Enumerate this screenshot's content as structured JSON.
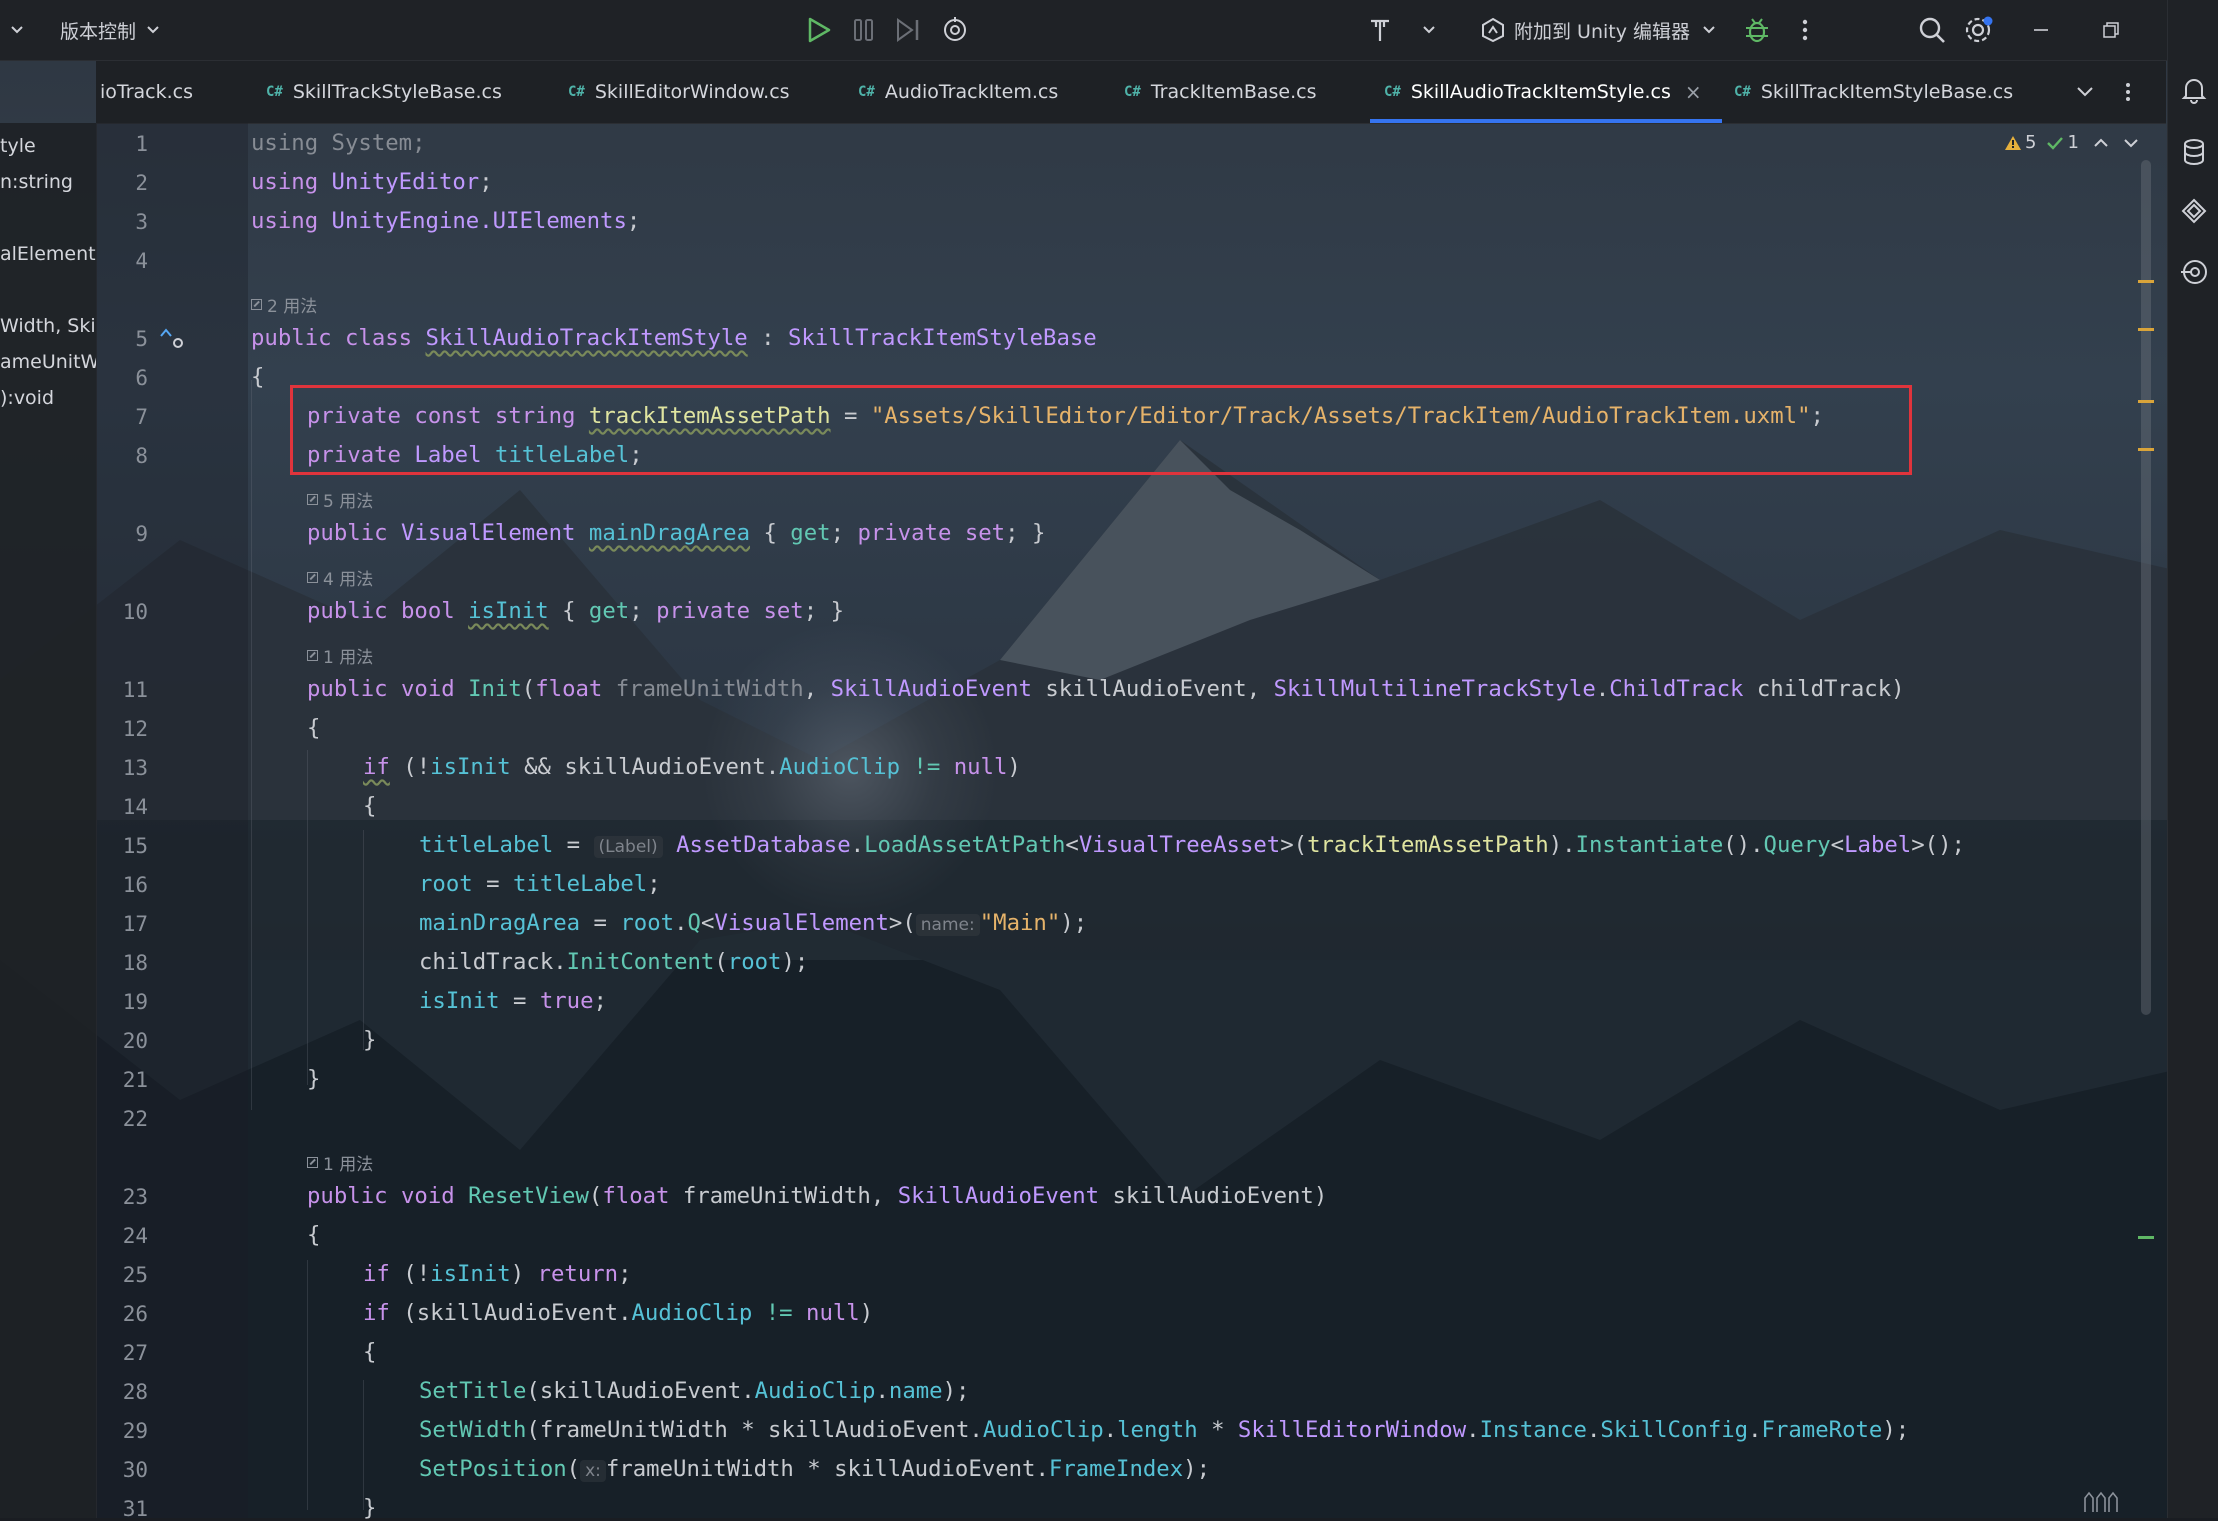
{
  "toolbar": {
    "left_fragment": "",
    "vcs_label": "版本控制",
    "attach_label": "附加到 Unity 编辑器"
  },
  "tabs": [
    {
      "label": "ioTrack.cs",
      "cs": false
    },
    {
      "label": "SkillTrackStyleBase.cs",
      "cs": true
    },
    {
      "label": "SkillEditorWindow.cs",
      "cs": true
    },
    {
      "label": "AudioTrackItem.cs",
      "cs": true
    },
    {
      "label": "TrackItemBase.cs",
      "cs": true
    },
    {
      "label": "SkillAudioTrackItemStyle.cs",
      "cs": true,
      "active": true
    },
    {
      "label": "SkillTrackItemStyleBase.cs",
      "cs": true
    }
  ],
  "cs_badge": "C#",
  "close_glyph": "×",
  "left_panel": [
    "tyle",
    "n:string",
    "alElement",
    "Width, Skil",
    "ameUnitWi",
    "):void"
  ],
  "inspections": {
    "warnings": "5",
    "ok": "1"
  },
  "usages": {
    "class": "2 用法",
    "mainDragArea": "5 用法",
    "isInit": "4 用法",
    "init": "1 用法",
    "resetView": "1 用法"
  },
  "inlay": {
    "label": "(Label)",
    "name": "name:",
    "x": "x:"
  },
  "line_numbers": [
    "1",
    "2",
    "3",
    "4",
    "5",
    "6",
    "7",
    "8",
    "9",
    "10",
    "11",
    "12",
    "13",
    "14",
    "15",
    "16",
    "17",
    "18",
    "19",
    "20",
    "21",
    "22",
    "23",
    "24",
    "25",
    "26",
    "27",
    "28",
    "29",
    "30",
    "31"
  ],
  "code": {
    "l1": "using System;",
    "l2a": "using ",
    "l2b": "UnityEditor",
    "l2c": ";",
    "l3a": "using ",
    "l3b": "UnityEngine.UIElements",
    "l3c": ";",
    "l5a": "public class ",
    "l5b": "SkillAudioTrackItemStyle",
    "l5c": " : ",
    "l5d": "SkillTrackItemStyleBase",
    "l6": "{",
    "l7a": "private const string ",
    "l7b": "trackItemAssetPath",
    "l7c": " = ",
    "l7d": "\"Assets/SkillEditor/Editor/Track/Assets/TrackItem/AudioTrackItem.uxml\"",
    "l7e": ";",
    "l8a": "private ",
    "l8b": "Label",
    "l8c": " ",
    "l8d": "titleLabel",
    "l8e": ";",
    "l9a": "public ",
    "l9b": "VisualElement",
    "l9c": " ",
    "l9d": "mainDragArea",
    "l9e": " { ",
    "l9f": "get",
    "l9g": "; ",
    "l9h": "private set",
    "l9i": "; }",
    "l10a": "public bool ",
    "l10b": "isInit",
    "l10c": " { ",
    "l10d": "get",
    "l10e": "; ",
    "l10f": "private set",
    "l10g": "; }",
    "l11a": "public void ",
    "l11b": "Init",
    "l11c": "(",
    "l11d": "float",
    "l11e": " frameUnitWidth",
    "l11f": ", ",
    "l11g": "SkillAudioEvent",
    "l11h": " skillAudioEvent, ",
    "l11i": "SkillMultilineTrackStyle",
    "l11j": ".",
    "l11k": "ChildTrack",
    "l11l": " childTrack)",
    "l12": "{",
    "l13a": "if",
    "l13b": " (!",
    "l13c": "isInit",
    "l13d": " && skillAudioEvent.",
    "l13e": "AudioClip",
    "l13f": " != ",
    "l13g": "null",
    "l13h": ")",
    "l14": "{",
    "l15a": "titleLabel",
    "l15b": " = ",
    "l15c": "AssetDatabase",
    "l15d": ".",
    "l15e": "LoadAssetAtPath",
    "l15f": "<",
    "l15g": "VisualTreeAsset",
    "l15h": ">(",
    "l15i": "trackItemAssetPath",
    "l15j": ").",
    "l15k": "Instantiate",
    "l15l": "().",
    "l15m": "Query",
    "l15n": "<",
    "l15o": "Label",
    "l15p": ">();",
    "l16a": "root",
    "l16b": " = ",
    "l16c": "titleLabel",
    "l16d": ";",
    "l17a": "mainDragArea",
    "l17b": " = ",
    "l17c": "root",
    "l17d": ".",
    "l17e": "Q",
    "l17f": "<",
    "l17g": "VisualElement",
    "l17h": ">(",
    "l17i": "\"Main\"",
    "l17j": ");",
    "l18a": "childTrack.",
    "l18b": "InitContent",
    "l18c": "(",
    "l18d": "root",
    "l18e": ");",
    "l19a": "isInit",
    "l19b": " = ",
    "l19c": "true",
    "l19d": ";",
    "l20": "}",
    "l21": "}",
    "l23a": "public void ",
    "l23b": "ResetView",
    "l23c": "(",
    "l23d": "float",
    "l23e": " frameUnitWidth, ",
    "l23f": "SkillAudioEvent",
    "l23g": " skillAudioEvent)",
    "l24": "{",
    "l25a": "if",
    "l25b": " (!",
    "l25c": "isInit",
    "l25d": ") ",
    "l25e": "return",
    "l25f": ";",
    "l26a": "if",
    "l26b": " (skillAudioEvent.",
    "l26c": "AudioClip",
    "l26d": " != ",
    "l26e": "null",
    "l26f": ")",
    "l27": "{",
    "l28a": "SetTitle",
    "l28b": "(skillAudioEvent.",
    "l28c": "AudioClip",
    "l28d": ".",
    "l28e": "name",
    "l28f": ");",
    "l29a": "SetWidth",
    "l29b": "(frameUnitWidth * skillAudioEvent.",
    "l29c": "AudioClip",
    "l29d": ".",
    "l29e": "length",
    "l29f": " * ",
    "l29g": "SkillEditorWindow",
    "l29h": ".",
    "l29i": "Instance",
    "l29j": ".",
    "l29k": "SkillConfig",
    "l29l": ".",
    "l29m": "FrameRote",
    "l29n": ");",
    "l30a": "SetPosition",
    "l30b": "(",
    "l30c": "frameUnitWidth * skillAudioEvent.",
    "l30d": "FrameIndex",
    "l30e": ");",
    "l31": "}"
  }
}
